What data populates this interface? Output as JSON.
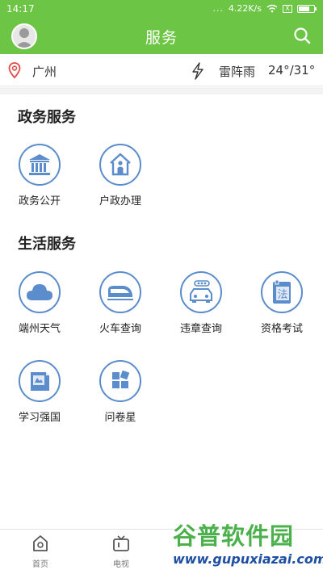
{
  "status_bar": {
    "time": "14:17",
    "dots": "...",
    "speed": "4.22K/s",
    "sim_mark": "X"
  },
  "header": {
    "title": "服务"
  },
  "info_bar": {
    "city": "广州",
    "weather": "雷阵雨",
    "temperature": "24°/31°"
  },
  "sections": [
    {
      "title": "政务服务",
      "items": [
        {
          "label": "政务公开",
          "icon": "government-building-icon"
        },
        {
          "label": "户政办理",
          "icon": "household-registration-icon"
        }
      ]
    },
    {
      "title": "生活服务",
      "items": [
        {
          "label": "端州天气",
          "icon": "cloud-icon"
        },
        {
          "label": "火车查询",
          "icon": "train-icon"
        },
        {
          "label": "违章查询",
          "icon": "car-icon"
        },
        {
          "label": "资格考试",
          "icon": "law-book-icon"
        },
        {
          "label": "学习强国",
          "icon": "study-book-icon"
        },
        {
          "label": "问卷星",
          "icon": "questionnaire-icon"
        }
      ]
    }
  ],
  "bottom_nav": [
    {
      "label": "首页",
      "icon": "home-icon"
    },
    {
      "label": "电视",
      "icon": "tv-icon"
    }
  ],
  "watermark": {
    "title": "谷普软件园",
    "url": "www.gupuxiazai.com"
  },
  "colors": {
    "green": "#6cc544",
    "icon_blue": "#5b8ccc",
    "watermark_green": "#4cb04d",
    "watermark_blue": "#1e4fa3"
  }
}
